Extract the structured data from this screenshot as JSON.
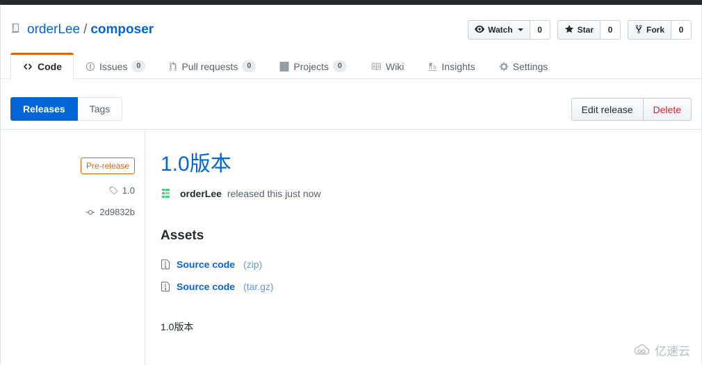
{
  "header": {
    "repo_icon": "repo-icon",
    "owner": "orderLee",
    "separator": "/",
    "name": "composer",
    "social": [
      {
        "icon": "eye-icon",
        "label": "Watch",
        "count": "0",
        "has_caret": true
      },
      {
        "icon": "star-icon",
        "label": "Star",
        "count": "0",
        "has_caret": false
      },
      {
        "icon": "fork-icon",
        "label": "Fork",
        "count": "0",
        "has_caret": false
      }
    ]
  },
  "nav": {
    "items": [
      {
        "icon": "code-icon",
        "label": "Code",
        "count": null,
        "selected": true
      },
      {
        "icon": "issue-icon",
        "label": "Issues",
        "count": "0",
        "selected": false
      },
      {
        "icon": "pull-icon",
        "label": "Pull requests",
        "count": "0",
        "selected": false
      },
      {
        "icon": "project-icon",
        "label": "Projects",
        "count": "0",
        "selected": false
      },
      {
        "icon": "wiki-icon",
        "label": "Wiki",
        "count": null,
        "selected": false
      },
      {
        "icon": "insights-icon",
        "label": "Insights",
        "count": null,
        "selected": false
      },
      {
        "icon": "gear-icon",
        "label": "Settings",
        "count": null,
        "selected": false
      }
    ]
  },
  "subnav": {
    "releases_label": "Releases",
    "tags_label": "Tags",
    "edit_label": "Edit release",
    "delete_label": "Delete"
  },
  "release": {
    "badge": "Pre-release",
    "tag": "1.0",
    "commit": "2d9832b",
    "title": "1.0版本",
    "author": "orderLee",
    "byline_suffix": "released this just now",
    "assets_heading": "Assets",
    "assets": [
      {
        "name": "Source code",
        "ext": "(zip)"
      },
      {
        "name": "Source code",
        "ext": "(tar.gz)"
      }
    ],
    "body": "1.0版本"
  },
  "watermark": {
    "text": "亿速云"
  },
  "colors": {
    "accent_orange": "#e36209",
    "link_blue": "#0366d6",
    "danger_red": "#cb2431",
    "active_blue": "#0366d6",
    "border": "#e1e4e8",
    "topbar": "#24292e"
  }
}
